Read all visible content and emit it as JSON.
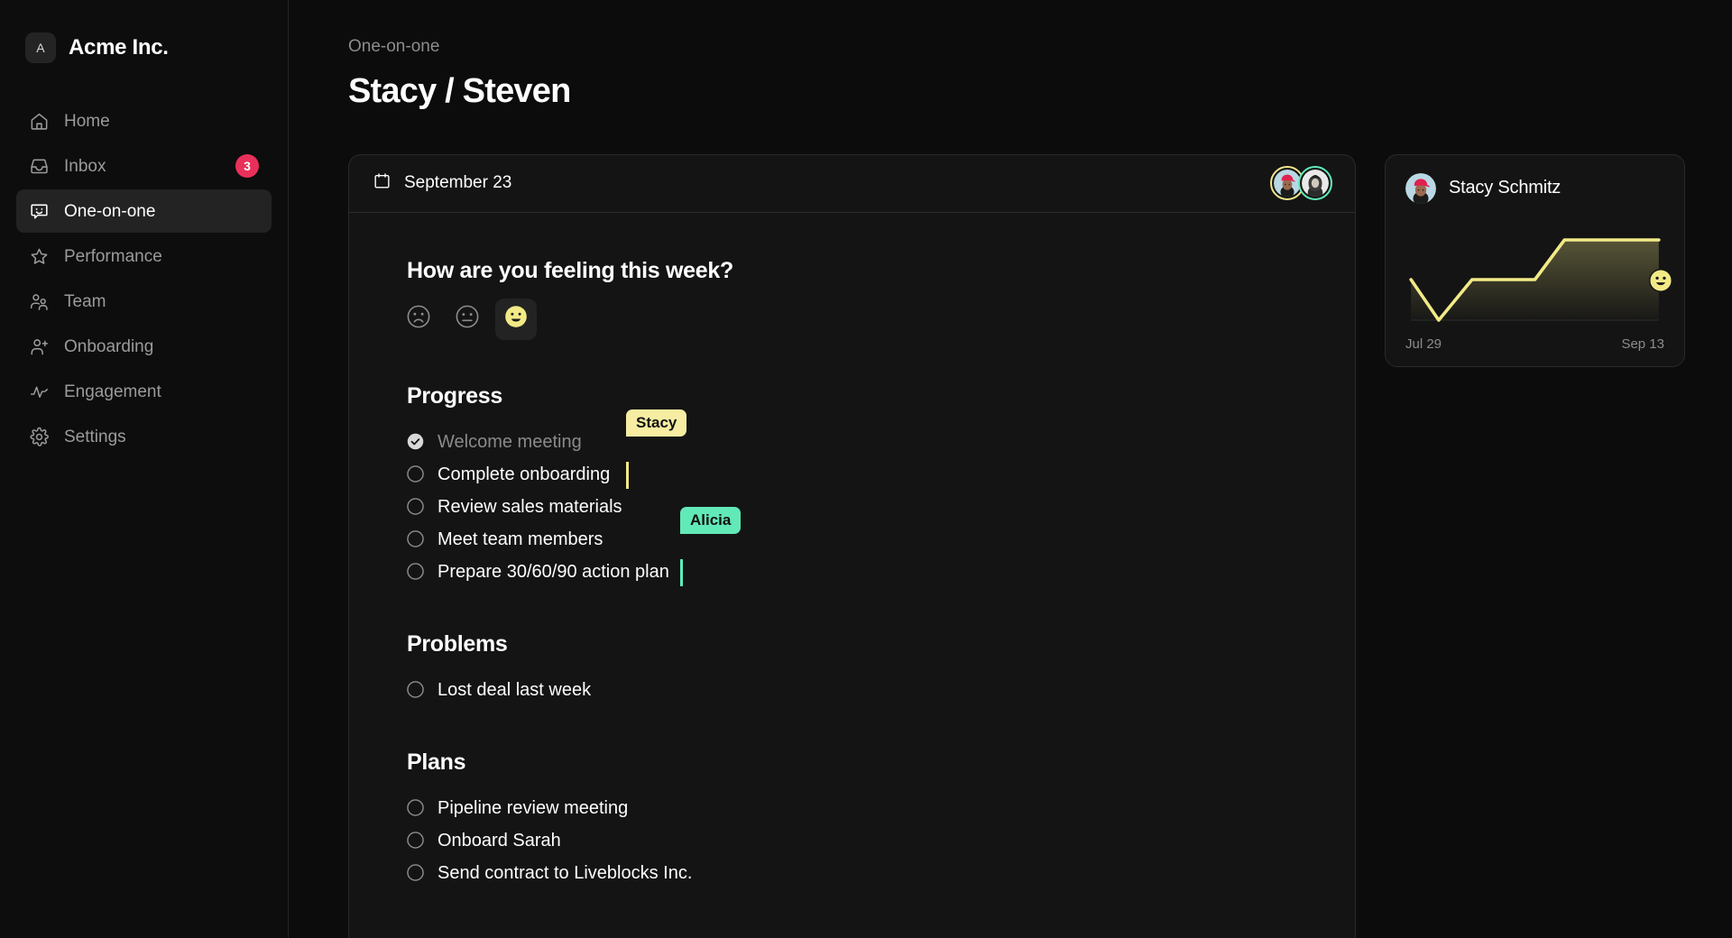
{
  "sidebar": {
    "brand": {
      "logo_letter": "A",
      "name": "Acme Inc."
    },
    "items": [
      {
        "label": "Home",
        "icon": "home-icon",
        "badge": null,
        "active": false
      },
      {
        "label": "Inbox",
        "icon": "inbox-icon",
        "badge": "3",
        "active": false
      },
      {
        "label": "One-on-one",
        "icon": "chat-smile-icon",
        "badge": null,
        "active": true
      },
      {
        "label": "Performance",
        "icon": "star-icon",
        "badge": null,
        "active": false
      },
      {
        "label": "Team",
        "icon": "users-icon",
        "badge": null,
        "active": false
      },
      {
        "label": "Onboarding",
        "icon": "user-plus-icon",
        "badge": null,
        "active": false
      },
      {
        "label": "Engagement",
        "icon": "activity-pulse-icon",
        "badge": null,
        "active": false
      },
      {
        "label": "Settings",
        "icon": "gear-icon",
        "badge": null,
        "active": false
      }
    ],
    "badge_color": "#e8305a"
  },
  "header": {
    "breadcrumb": "One-on-one",
    "title": "Stacy / Steven"
  },
  "document": {
    "date": "September 23",
    "presence": [
      {
        "name": "Stacy",
        "ring_color": "#f0e68c"
      },
      {
        "name": "Steven",
        "ring_color": "#5feaba"
      }
    ],
    "mood": {
      "question": "How are you feeling this week?",
      "options": [
        {
          "name": "sad-face-icon",
          "selected": false
        },
        {
          "name": "neutral-face-icon",
          "selected": false
        },
        {
          "name": "happy-face-icon",
          "selected": true
        }
      ],
      "selected_color": "#f2ea86"
    },
    "sections": [
      {
        "title": "Progress",
        "items": [
          {
            "text": "Welcome meeting",
            "done": true
          },
          {
            "text": "Complete onboarding",
            "done": false
          },
          {
            "text": "Review sales materials",
            "done": false
          },
          {
            "text": "Meet team members",
            "done": false
          },
          {
            "text": "Prepare 30/60/90 action plan",
            "done": false
          }
        ]
      },
      {
        "title": "Problems",
        "items": [
          {
            "text": "Lost deal last week",
            "done": false
          }
        ]
      },
      {
        "title": "Plans",
        "items": [
          {
            "text": "Pipeline review meeting",
            "done": false
          },
          {
            "text": "Onboard Sarah",
            "done": false
          },
          {
            "text": "Send contract to Liveblocks Inc.",
            "done": false
          }
        ]
      }
    ],
    "cursors": [
      {
        "name": "Stacy",
        "color": "#f6eda2",
        "caret_color": "#f2ea86"
      },
      {
        "name": "Alicia",
        "color": "#62e9b8",
        "caret_color": "#5feaba"
      }
    ]
  },
  "stat_card": {
    "person": "Stacy Schmitz",
    "start_label": "Jul 29",
    "end_label": "Sep 13",
    "endpoint_icon": "happy-face-icon"
  },
  "chart_data": {
    "type": "line",
    "title": "Stacy Schmitz",
    "xlabel": "",
    "ylabel": "",
    "line_color": "#f2ea86",
    "fill": "gradient",
    "grid": false,
    "legend": null,
    "x_tick_labels": [
      "Jul 29",
      "Sep 13"
    ],
    "x": [
      0,
      1,
      2,
      3,
      4,
      5,
      6,
      7
    ],
    "y": [
      2,
      0,
      2,
      2,
      2,
      3,
      3,
      3
    ],
    "ylim": [
      0,
      3.4
    ],
    "annotation": "happy-face-icon at final point"
  }
}
